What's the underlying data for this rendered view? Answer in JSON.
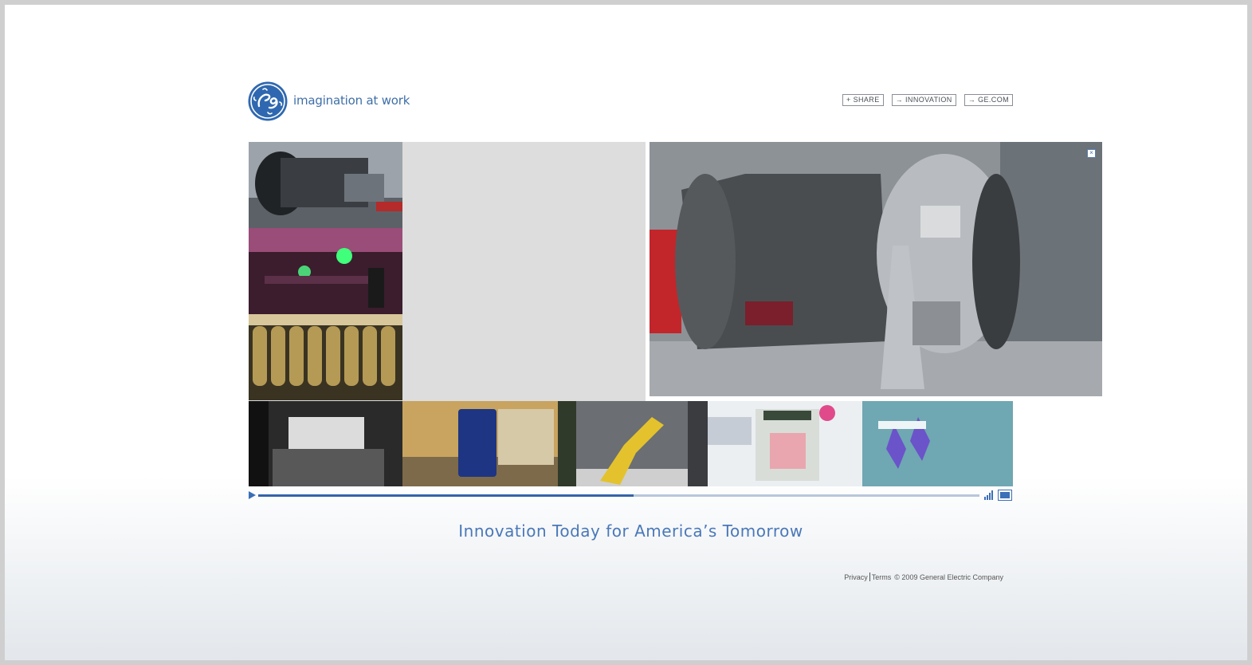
{
  "brand": {
    "tagline": "imagination at work",
    "accent": "#3b6fb6"
  },
  "nav": {
    "share": {
      "glyph": "+",
      "label": "SHARE"
    },
    "innovation": {
      "glyph": "→",
      "label": "INNOVATION"
    },
    "gecom": {
      "glyph": "→",
      "label": "GE.COM"
    }
  },
  "video": {
    "close_label": "×",
    "progress": 0.52
  },
  "headline": "Innovation Today for America’s Tomorrow",
  "footer": {
    "privacy": "Privacy",
    "terms": "Terms",
    "copyright": "© 2009 General Electric Company"
  },
  "icons": {
    "play": "play-icon",
    "volume": "volume-icon",
    "fullscreen": "fullscreen-icon"
  }
}
